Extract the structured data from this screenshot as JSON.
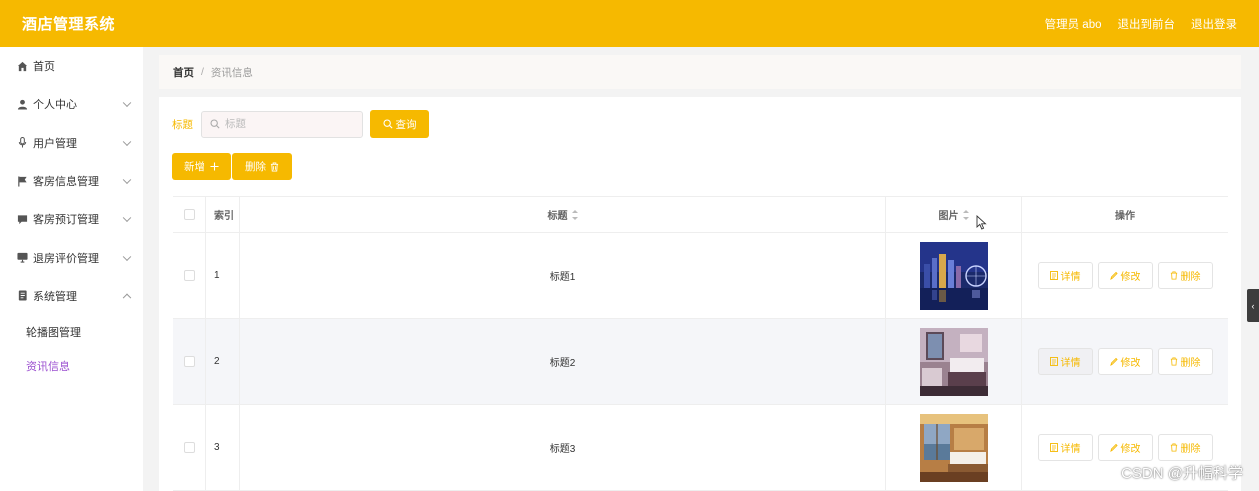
{
  "header": {
    "title": "酒店管理系统",
    "admin_label": "管理员 abo",
    "to_front": "退出到前台",
    "logout": "退出登录"
  },
  "sidebar": {
    "items": [
      {
        "label": "首页",
        "icon": "home-icon"
      },
      {
        "label": "个人中心",
        "icon": "user-icon"
      },
      {
        "label": "用户管理",
        "icon": "microphone-icon"
      },
      {
        "label": "客房信息管理",
        "icon": "flag-icon"
      },
      {
        "label": "客房预订管理",
        "icon": "chat-icon"
      },
      {
        "label": "退房评价管理",
        "icon": "monitor-icon"
      },
      {
        "label": "系统管理",
        "icon": "notebook-icon"
      }
    ],
    "sub_items": [
      {
        "label": "轮播图管理",
        "active": false
      },
      {
        "label": "资讯信息",
        "active": true
      }
    ],
    "active_color": "#9b4fd0"
  },
  "breadcrumb": {
    "home": "首页",
    "separator": "/",
    "current": "资讯信息"
  },
  "search": {
    "label": "标题",
    "placeholder": "标题",
    "value": "",
    "query_button": "查询"
  },
  "actions": {
    "add_button": "新增",
    "delete_button": "删除"
  },
  "table": {
    "columns": {
      "index": "索引",
      "title": "标题",
      "image": "图片",
      "operations": "操作"
    },
    "rows": [
      {
        "index": "1",
        "title": "标题1",
        "image": "city-night-skyline-photo"
      },
      {
        "index": "2",
        "title": "标题2",
        "image": "hotel-room-photo"
      },
      {
        "index": "3",
        "title": "标题3",
        "image": "hotel-room-view-photo"
      }
    ],
    "row_buttons": {
      "detail": "详情",
      "edit": "修改",
      "delete": "删除"
    }
  },
  "watermark": "CSDN @升幅科学",
  "colors": {
    "primary": "#f6b900",
    "header_text": "#ffffff"
  }
}
